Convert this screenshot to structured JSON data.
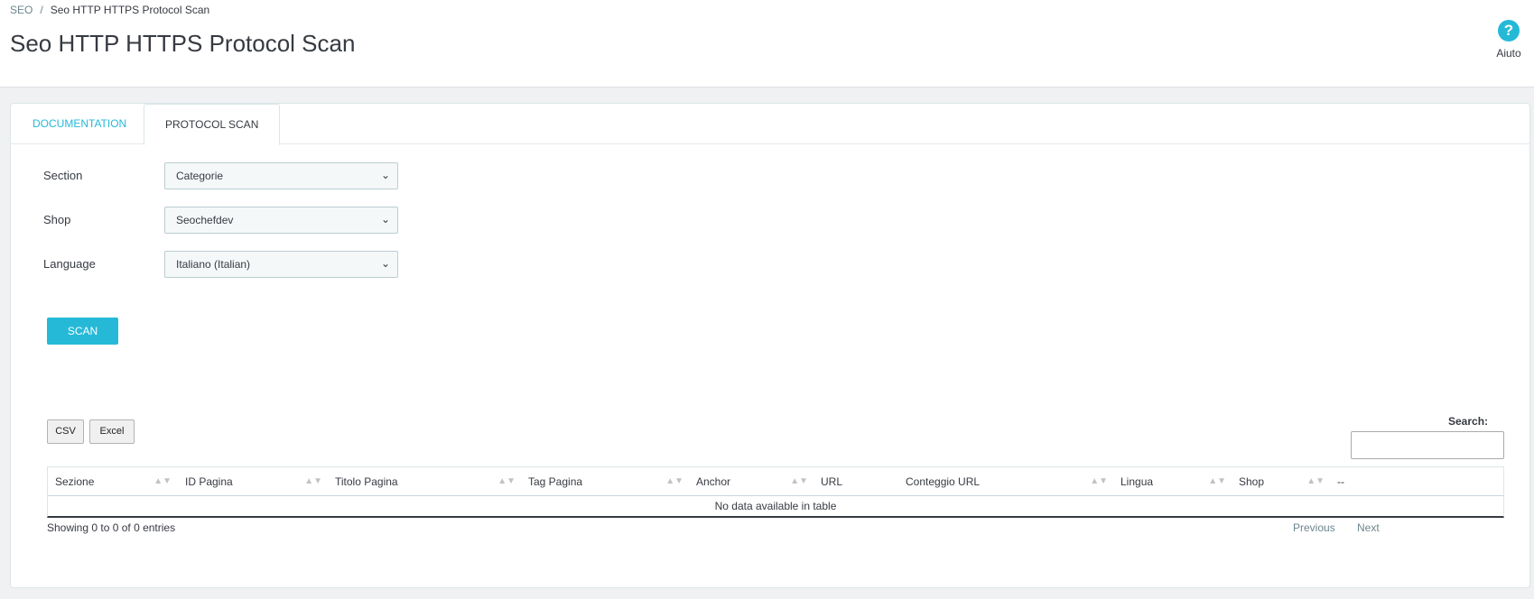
{
  "breadcrumb": {
    "parent": "SEO",
    "separator": "/",
    "current": "Seo HTTP HTTPS Protocol Scan"
  },
  "page": {
    "title": "Seo HTTP HTTPS Protocol Scan"
  },
  "help": {
    "icon": "question-circle-icon",
    "glyph": "?",
    "label": "Aiuto"
  },
  "tabs": [
    {
      "label": "DOCUMENTATION",
      "active": false
    },
    {
      "label": "PROTOCOL SCAN",
      "active": true
    }
  ],
  "form": {
    "section": {
      "label": "Section",
      "value": "Categorie"
    },
    "shop": {
      "label": "Shop",
      "value": "Seochefdev"
    },
    "language": {
      "label": "Language",
      "value": "Italiano (Italian)"
    },
    "scan_label": "SCAN"
  },
  "export": {
    "csv_label": "CSV",
    "excel_label": "Excel"
  },
  "search": {
    "label": "Search:",
    "value": ""
  },
  "table": {
    "columns": [
      "Sezione",
      "ID Pagina",
      "Titolo Pagina",
      "Tag Pagina",
      "Anchor",
      "URL",
      "Conteggio URL",
      "Lingua",
      "Shop",
      "--"
    ],
    "empty_message": "No data available in table"
  },
  "footer": {
    "info": "Showing 0 to 0 of 0 entries",
    "previous": "Previous",
    "next": "Next"
  },
  "colors": {
    "accent": "#25b9d7",
    "text": "#363a41",
    "muted": "#6c868e"
  }
}
